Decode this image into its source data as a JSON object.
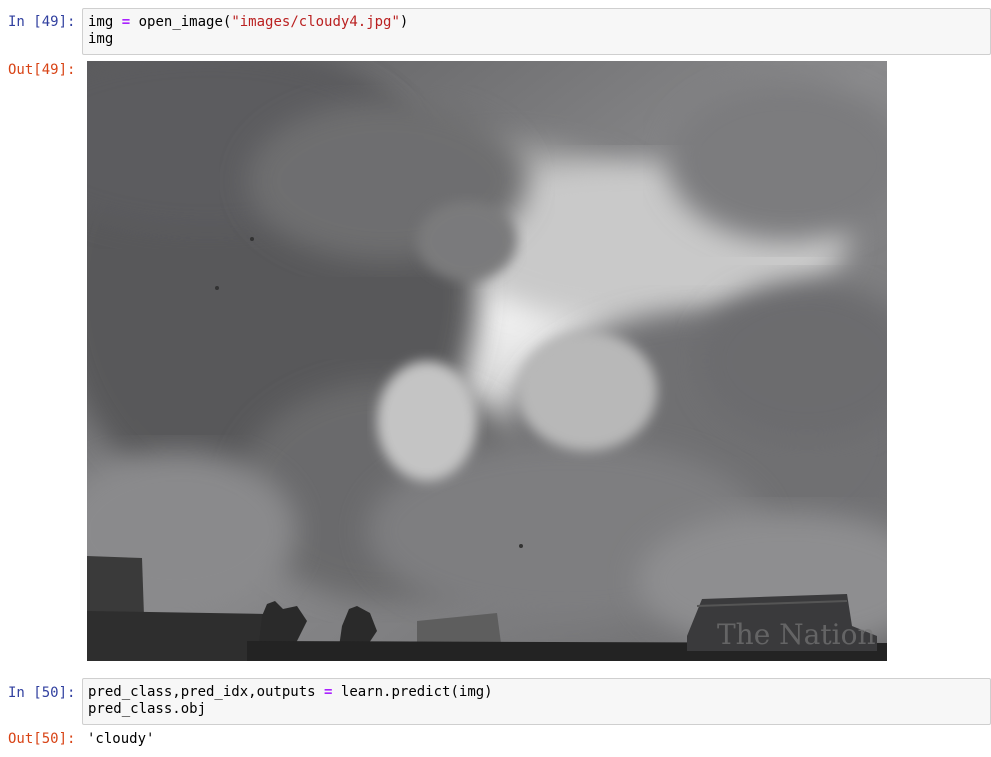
{
  "cells": [
    {
      "in_prompt": "In [49]:",
      "code_line1": {
        "var": "img",
        "op": "=",
        "func": "open_image(",
        "str": "\"images/cloudy4.jpg\"",
        "close": ")"
      },
      "code_line2": "img",
      "out_prompt": "Out[49]:",
      "output_image": {
        "alt": "cloudy-sky-photo",
        "watermark": "The Nation"
      }
    },
    {
      "in_prompt": "In [50]:",
      "code_line1": {
        "lhs": "pred_class,pred_idx,outputs",
        "op": "=",
        "rhs": "learn.predict(img)"
      },
      "code_line2": "pred_class.obj",
      "out_prompt": "Out[50]:",
      "output_text": "'cloudy'"
    }
  ],
  "colors": {
    "in_prompt": "#303F9F",
    "out_prompt": "#D84315",
    "operator": "#AA22FF",
    "string": "#BA2121",
    "input_bg": "#f7f7f7",
    "input_border": "#cfcfcf"
  }
}
